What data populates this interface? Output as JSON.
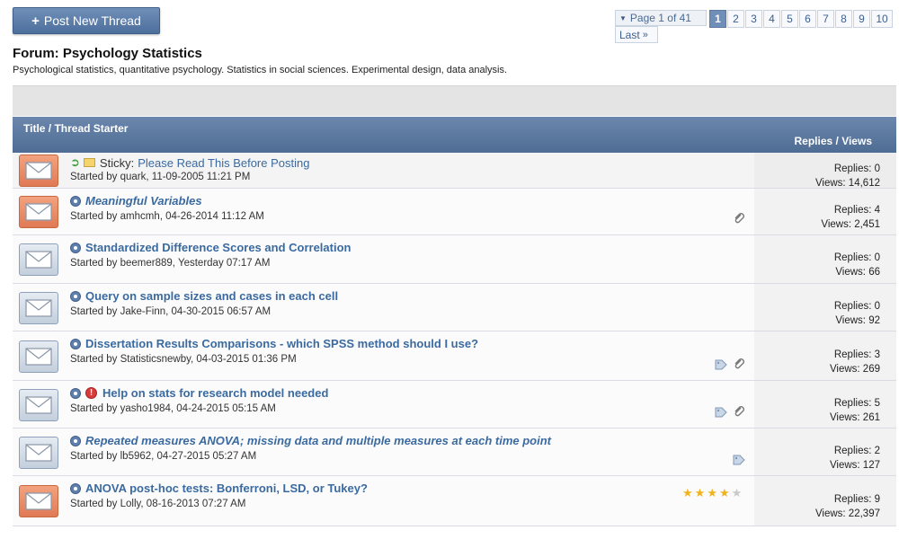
{
  "toolbar": {
    "post_label": "Post New Thread"
  },
  "pager": {
    "label": "Page 1 of 41",
    "pages": [
      "1",
      "2",
      "3",
      "4",
      "5",
      "6",
      "7",
      "8",
      "9",
      "10"
    ],
    "current": "1",
    "last_label": "Last"
  },
  "forum": {
    "title": "Forum: Psychology Statistics",
    "description": "Psychological statistics, quantitative psychology. Statistics in social sciences. Experimental design, data analysis."
  },
  "table": {
    "col_title": "Title / Thread Starter",
    "col_stats": "Replies / Views"
  },
  "threads": [
    {
      "sticky": true,
      "sticky_label": "Sticky:",
      "title": "Please Read This Before Posting",
      "starter": "Started by quark, 11-09-2005 11:21 PM",
      "replies": "Replies: 0",
      "views": "Views: 14,612",
      "icon": "orange",
      "style": "plain"
    },
    {
      "title": "Meaningful Variables",
      "starter": "Started by amhcmh, 04-26-2014 11:12 AM",
      "replies": "Replies: 4",
      "views": "Views: 2,451",
      "icon": "orange",
      "style": "it",
      "attachment": true
    },
    {
      "title": "Standardized Difference Scores and Correlation",
      "starter": "Started by beemer889, Yesterday 07:17 AM",
      "replies": "Replies: 0",
      "views": "Views: 66",
      "icon": "blue",
      "style": "bold"
    },
    {
      "title": "Query on sample sizes and cases in each cell",
      "starter": "Started by Jake-Finn, 04-30-2015 06:57 AM",
      "replies": "Replies: 0",
      "views": "Views: 92",
      "icon": "blue",
      "style": "bold"
    },
    {
      "title": "Dissertation Results Comparisons - which SPSS method should I use?",
      "starter": "Started by Statisticsnewby, 04-03-2015 01:36 PM",
      "replies": "Replies: 3",
      "views": "Views: 269",
      "icon": "blue",
      "style": "bold",
      "tag": true,
      "attachment": true
    },
    {
      "title": "Help on stats for research model needed",
      "starter": "Started by yasho1984, 04-24-2015 05:15 AM",
      "replies": "Replies: 5",
      "views": "Views: 261",
      "icon": "blue",
      "style": "bold",
      "urgent": true,
      "tag": true,
      "attachment": true
    },
    {
      "title": "Repeated measures ANOVA; missing data and multiple measures at each time point",
      "starter": "Started by lb5962, 04-27-2015 05:27 AM",
      "replies": "Replies: 2",
      "views": "Views: 127",
      "icon": "blue",
      "style": "it",
      "tag": true
    },
    {
      "title": "ANOVA post-hoc tests: Bonferroni, LSD, or Tukey?",
      "starter": "Started by Lolly, 08-16-2013 07:27 AM",
      "replies": "Replies: 9",
      "views": "Views: 22,397",
      "icon": "orange",
      "style": "bold",
      "rating": 4,
      "rating_max": 5
    }
  ],
  "colors": {
    "accent": "#4f6c94",
    "link": "#3a6aa0",
    "hot_icon": "#e07a55"
  }
}
